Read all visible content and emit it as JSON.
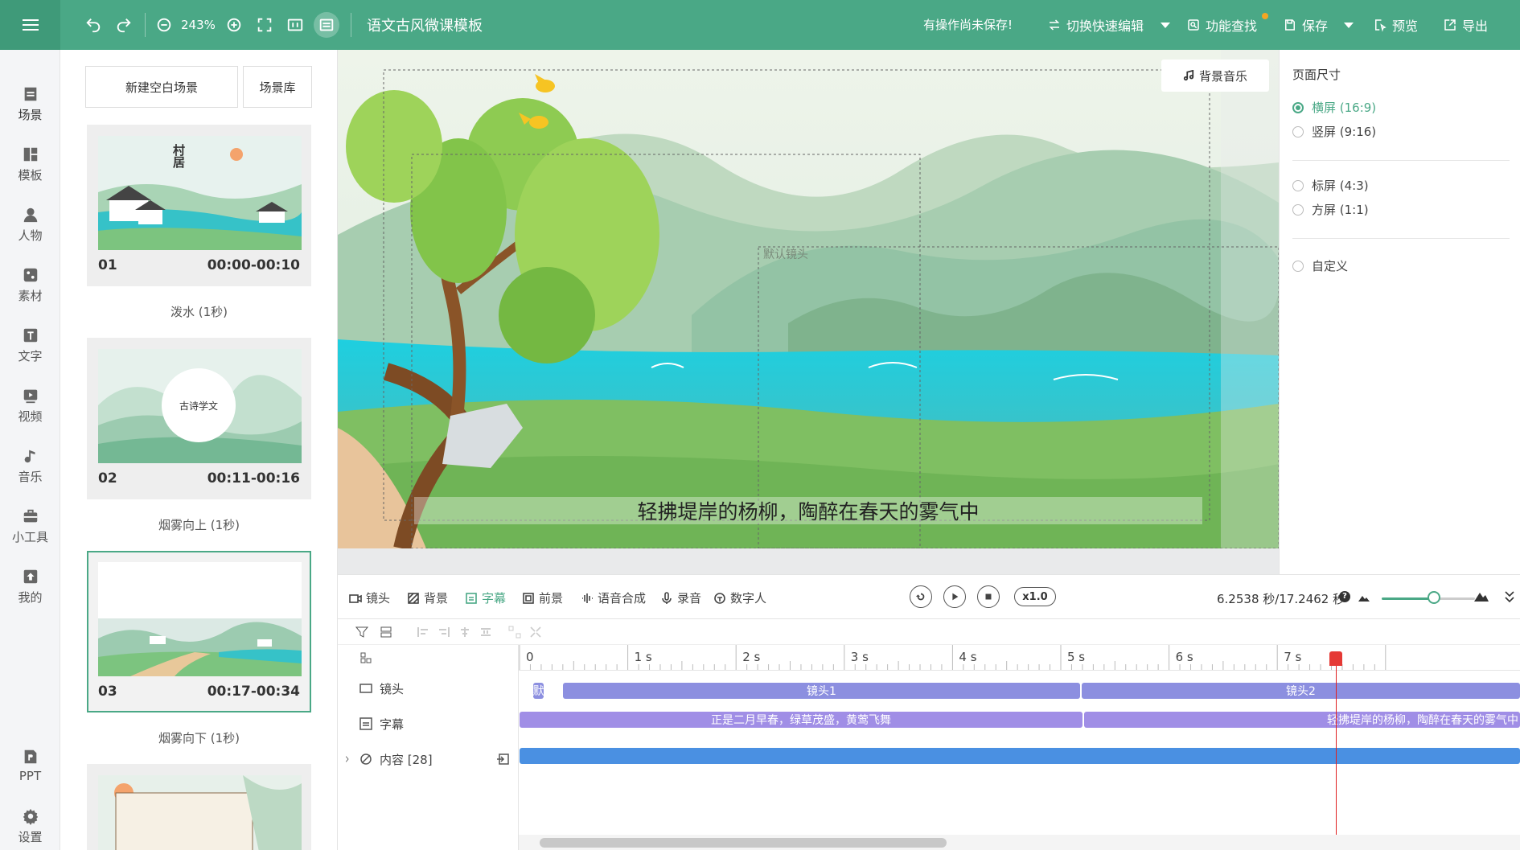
{
  "header": {
    "zoom": "243%",
    "title": "语文古风微课模板",
    "unsaved": "有操作尚未保存!",
    "quick_edit": "切换快速编辑",
    "feature_search": "功能查找",
    "save": "保存",
    "preview": "预览",
    "export": "导出",
    "accent_color": "#4aa886",
    "icons": [
      "menu-icon",
      "undo-icon",
      "redo-icon",
      "zoom-out-icon",
      "zoom-in-icon",
      "fullscreen-icon",
      "ratio-icon",
      "subtitle-icon"
    ]
  },
  "nav": {
    "items": [
      {
        "label": "场景",
        "icon": "scene-icon"
      },
      {
        "label": "模板",
        "icon": "template-icon"
      },
      {
        "label": "人物",
        "icon": "person-icon"
      },
      {
        "label": "素材",
        "icon": "material-icon"
      },
      {
        "label": "文字",
        "icon": "text-icon"
      },
      {
        "label": "视频",
        "icon": "video-icon"
      },
      {
        "label": "音乐",
        "icon": "music-icon"
      },
      {
        "label": "小工具",
        "icon": "toolbox-icon"
      },
      {
        "label": "我的",
        "icon": "upload-icon"
      }
    ],
    "bottom": [
      {
        "label": "PPT",
        "icon": "ppt-icon"
      },
      {
        "label": "设置",
        "icon": "settings-icon"
      }
    ]
  },
  "scenes": {
    "new_blank": "新建空白场景",
    "library": "场景库",
    "items": [
      {
        "num": "01",
        "time": "00:00-00:10",
        "transition": "泼水 (1秒)",
        "thumb_title": "村居"
      },
      {
        "num": "02",
        "time": "00:11-00:16",
        "transition": "烟雾向上 (1秒)",
        "thumb_title": "古诗学文"
      },
      {
        "num": "03",
        "time": "00:17-00:34",
        "transition": "烟雾向下 (1秒)"
      }
    ]
  },
  "canvas": {
    "bgm": "背景音乐",
    "lens_label": "默认镜头",
    "subtitle": "轻拂堤岸的杨柳，陶醉在春天的雾气中"
  },
  "props": {
    "title": "页面尺寸",
    "options": [
      {
        "label": "横屏 (16:9)",
        "selected": true
      },
      {
        "label": "竖屏 (9:16)",
        "selected": false
      },
      {
        "label": "标屏 (4:3)",
        "selected": false
      },
      {
        "label": "方屏 (1:1)",
        "selected": false
      },
      {
        "label": "自定义",
        "selected": false
      }
    ]
  },
  "timeline": {
    "tabs": [
      {
        "label": "镜头",
        "active": false
      },
      {
        "label": "背景",
        "active": false
      },
      {
        "label": "字幕",
        "active": true
      },
      {
        "label": "前景",
        "active": false
      },
      {
        "label": "语音合成",
        "active": false
      },
      {
        "label": "录音",
        "active": false
      },
      {
        "label": "数字人",
        "active": false
      }
    ],
    "speed": "x1.0",
    "current": "6.2538 秒/17.2462 秒",
    "ticks": [
      "0",
      "1 s",
      "2 s",
      "3 s",
      "4 s",
      "5 s",
      "6 s",
      "7 s"
    ],
    "tracks": [
      {
        "label": "镜头"
      },
      {
        "label": "字幕"
      },
      {
        "label": "内容 [28]"
      }
    ],
    "lens_clips": [
      "默",
      "镜头1",
      "镜头2"
    ],
    "subtitle_clips": [
      "正是二月早春，绿草茂盛，黄莺飞舞",
      "轻拂堤岸的杨柳，陶醉在春天的雾气中"
    ],
    "playhead_seconds": 6.2538,
    "total_seconds": 17.2462
  }
}
